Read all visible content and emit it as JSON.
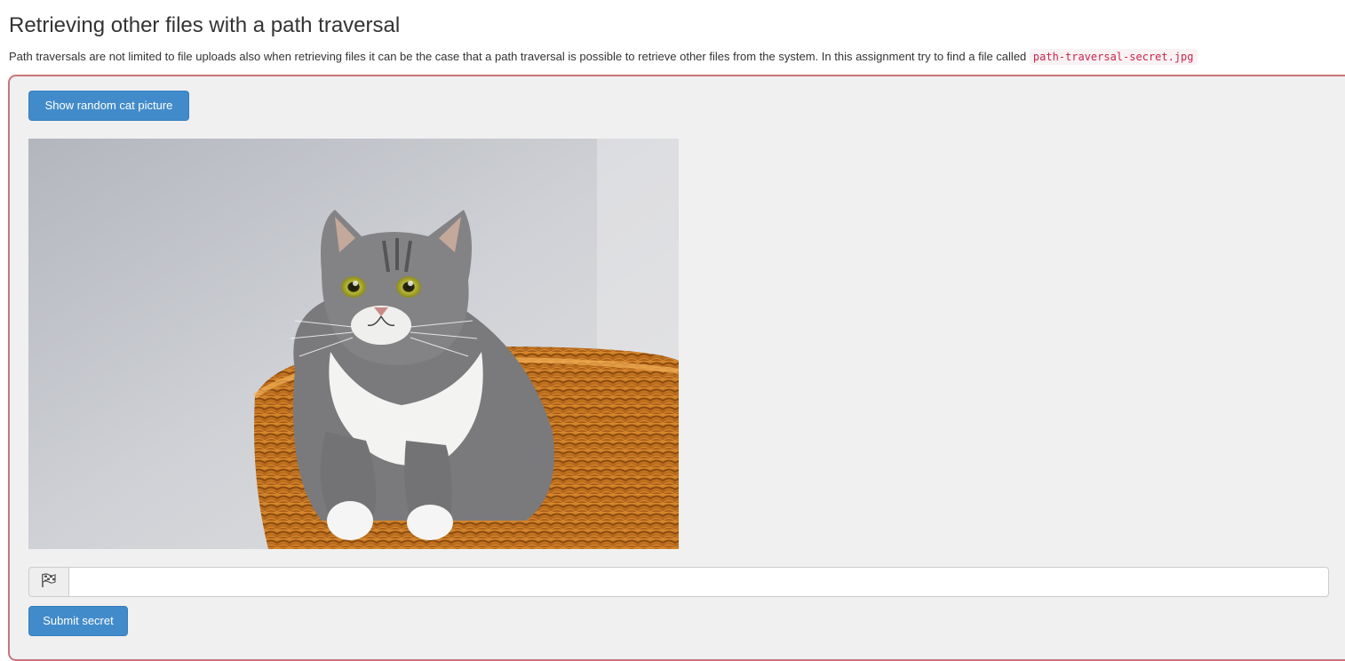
{
  "page": {
    "title": "Retrieving other files with a path traversal",
    "description_text": "Path traversals are not limited to file uploads also when retrieving files it can be the case that a path traversal is possible to retrieve other files from the system. In this assignment try to find a file called ",
    "description_code": "path-traversal-secret.jpg"
  },
  "assignment": {
    "show_button_label": "Show random cat picture",
    "image_subject": "grey and white tabby cat sitting in an orange wicker basket",
    "flag_icon": "flag-icon",
    "secret_input_value": "",
    "secret_input_placeholder": "",
    "submit_button_label": "Submit secret"
  },
  "colors": {
    "primary_button": "#428bca",
    "panel_border": "#c9757b",
    "panel_background": "#f0f0f0",
    "code_text": "#c7254e",
    "code_background": "#f9f2f4"
  }
}
